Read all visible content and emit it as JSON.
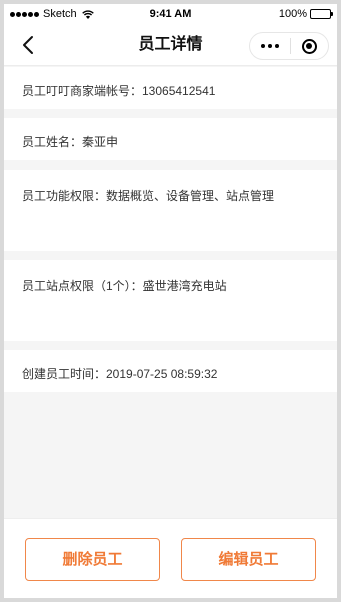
{
  "status_bar": {
    "carrier": "Sketch",
    "time": "9:41 AM",
    "battery": "100%",
    "battery_level": 1.0
  },
  "nav": {
    "title": "员工详情",
    "back_icon": "chevron-left-icon",
    "more_icon": "more-dots-icon",
    "close_icon": "target-circle-icon"
  },
  "details": {
    "account": "员工叮叮商家端帐号：13065412541",
    "name": "员工姓名：秦亚申",
    "permissions": "员工功能权限：数据概览、设备管理、站点管理",
    "sites": "员工站点权限（1个）：盛世港湾充电站",
    "created": "创建员工时间：2019-07-25 08:59:32"
  },
  "actions": {
    "delete_label": "删除员工",
    "edit_label": "编辑员工",
    "accent_color": "#f07a36"
  }
}
